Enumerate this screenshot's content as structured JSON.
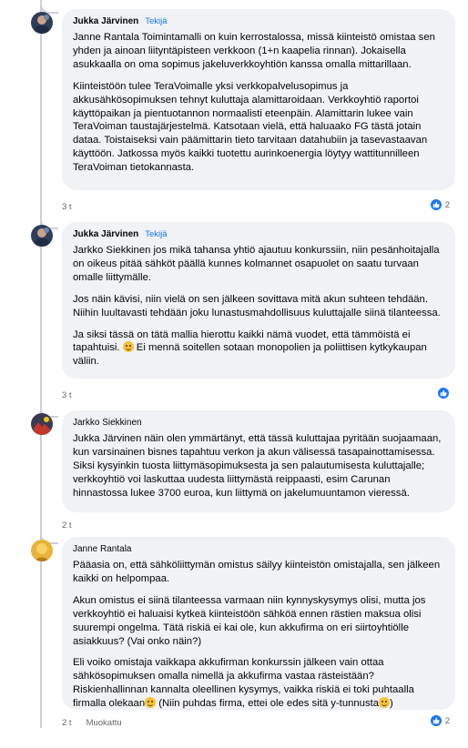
{
  "comments": [
    {
      "author": "Jukka Järvinen",
      "badge": "Tekijä",
      "paragraphs": [
        "Janne Rantala Toimintamalli on kuin kerrostalossa, missä kiinteistö omistaa sen yhden ja ainoan liityntäpisteen verkkoon (1+n kaapelia rinnan). Jokaisella asukkaalla on oma sopimus jakeluverkkoyhtiön kanssa omalla mittarillaan.",
        "Kiinteistöön tulee TeraVoimalle yksi verkkopalvelusopimus ja akkusähkösopimuksen tehnyt kuluttaja alamittaroidaan. Verkkoyhtiö raportoi käyttöpaikan ja pientuotannon normaalisti eteenpäin. Alamittarin lukee vain TeraVoiman taustajärjestelmä. Katsotaan vielä, että haluaako FG tästä jotain dataa. Toistaiseksi vain päämittarin tieto tarvitaan datahubiin ja tasevastaavan käyttöön. Jatkossa myös kaikki tuotettu aurinkoenergia löytyy wattitunnilleen TeraVoiman tietokannasta."
      ],
      "time": "3 t",
      "edited": "",
      "reactions": "2"
    },
    {
      "author": "Jukka Järvinen",
      "badge": "Tekijä",
      "paragraphs": [
        "Jarkko Siekkinen jos mikä tahansa yhtiö ajautuu konkurssiin, niin pesänhoitajalla on oikeus pitää sähköt päällä kunnes kolmannet osapuolet on saatu turvaan omalle liittymälle.",
        "Jos näin kävisi, niin vielä on sen jälkeen sovittava mitä akun suhteen tehdään. Niihin luultavasti tehdään joku lunastusmahdollisuus kuluttajalle siinä tilanteessa.",
        "Ja siksi tässä on tätä mallia hierottu kaikki nämä vuodet, että tämmöistä ei tapahtuisi.",
        " Ei mennä soitellen sotaan monopolien ja poliittisen kytkykaupan väliin."
      ],
      "time": "3 t",
      "edited": "",
      "reactions": ""
    },
    {
      "author": "Jarkko Siekkinen",
      "badge": "",
      "paragraphs": [
        "Jukka Järvinen näin olen ymmärtänyt, että tässä kuluttajaa pyritään suojaamaan, kun varsinainen bisnes tapahtuu verkon ja akun välisessä tasapainottamisessa. Siksi kysyinkin tuosta liittymäsopimuksesta ja sen palautumisesta kuluttajalle; verkkoyhtiö voi laskuttaa uudesta liittymästä reippaasti, esim Carunan hinnastossa lukee 3700 euroa, kun liittymä on jakelumuuntamon vieressä."
      ],
      "time": "2 t",
      "edited": "",
      "reactions": ""
    },
    {
      "author": "Janne Rantala",
      "badge": "",
      "paragraphs": [
        "Pääasia on, että sähköliittymän omistus säilyy kiinteistön omistajalla, sen jälkeen kaikki on helpompaa.",
        "Akun omistus ei siinä tilanteessa varmaan niin kynnyskysymys olisi, mutta jos verkkoyhtiö ei haluaisi kytkeä kiinteistöön sähköä ennen rästien maksua olisi suurempi ongelma. Tätä riskiä ei kai ole, kun akkufirma on eri siirtoyhtiölle asiakkuus? (Vai onko näin?)",
        "Eli voiko omistaja vaikkapa akkufirman konkurssin jälkeen vain ottaa sähkösopimuksen omalla nimellä ja akkufirma vastaa rästeistään? Riskienhallinnan kannalta oleellinen kysymys, vaikka riskiä ei toki puhtaalla firmalla olekaan",
        " (Niin puhdas firma, ettei ole edes sitä y-tunnusta",
        ")"
      ],
      "time": "2 t",
      "edited": "Muokattu",
      "reactions": "2"
    }
  ],
  "colors": {
    "link": "#1877f2",
    "bubble": "#f0f2f5",
    "meta": "#65676b"
  },
  "icons": {
    "like": "thumbs-up-icon",
    "emoji": "smiling-face-icon"
  }
}
